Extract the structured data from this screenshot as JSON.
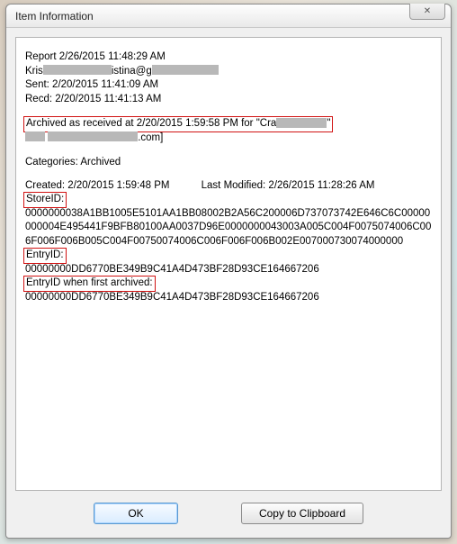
{
  "title": "Item Information",
  "close_glyph": "✕",
  "report_line": {
    "prefix": "Report ",
    "date": "2/26/2015 11:48:29 AM"
  },
  "from_line": {
    "name_start": "Kris",
    "name_end": "istina@g"
  },
  "sent_line": "Sent: 2/20/2015 11:41:09 AM",
  "recd_line": "Recd: 2/20/2015 11:41:13 AM",
  "archived_line": {
    "text_before": "Archived as received at 2/20/2015 1:59:58 PM for \"Cra",
    "text_after": "\""
  },
  "second_redacted_tail": ".com]",
  "categories": "Categories: Archived",
  "created_label": "Created: 2/20/2015 1:59:48 PM",
  "modified_label": "Last Modified: 2/26/2015 11:28:26 AM",
  "storeid_label": "StoreID:",
  "storeid_value": "0000000038A1BB1005E5101AA1BB08002B2A56C200006D737073742E646C6C00000000004E495441F9BFB80100AA0037D96E0000000043003A005C004F0075074006C006F006F006B005C004F00750074006C006F006F006B002E007000730074000000",
  "entryid_label": "EntryID:",
  "entryid_value": "00000000DD6770BE349B9C41A4D473BF28D93CE164667206",
  "entryid_first_label": "EntryID when first archived:",
  "entryid_first_value": "00000000DD6770BE349B9C41A4D473BF28D93CE164667206",
  "buttons": {
    "ok": "OK",
    "copy": "Copy to Clipboard"
  }
}
